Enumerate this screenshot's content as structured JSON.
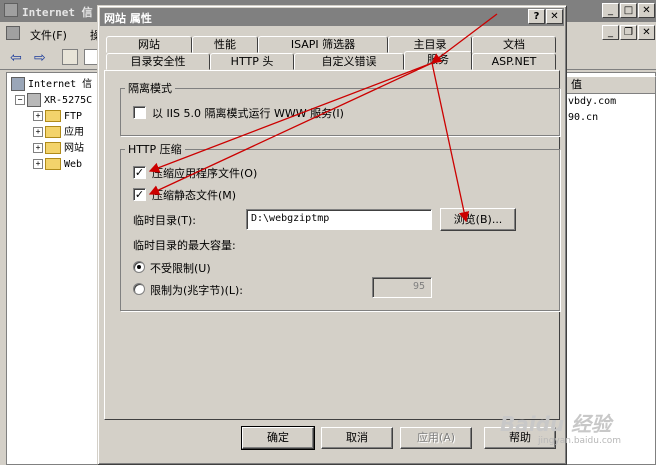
{
  "background_window": {
    "title": "Internet 信",
    "menu": {
      "file": "文件(F)",
      "action": "操"
    },
    "tree": {
      "root": "Internet 信",
      "server": "XR-5275C",
      "items": [
        "FTP",
        "应用",
        "网站",
        "Web"
      ]
    },
    "list_header": "值",
    "list_values": [
      "vbdy.com",
      "90.cn"
    ]
  },
  "dialog": {
    "title": "网站 属性",
    "tabs_row_back": [
      "网站",
      "性能",
      "ISAPI 筛选器",
      "主目录",
      "文档"
    ],
    "tabs_row_front": [
      "目录安全性",
      "HTTP 头",
      "自定义错误",
      "服务",
      "ASP.NET"
    ],
    "selected_tab": "服务",
    "isolation": {
      "group_label": "隔离模式",
      "checkbox_label": "以 IIS 5.0 隔离模式运行 WWW 服务(I)",
      "checked": false
    },
    "compression": {
      "group_label": "HTTP 压缩",
      "compress_app_files": {
        "label": "压缩应用程序文件(O)",
        "checked": true
      },
      "compress_static_files": {
        "label": "压缩静态文件(M)",
        "checked": true
      },
      "temp_dir_label": "临时目录(T):",
      "temp_dir_value": "D:\\webgziptmp",
      "browse_label": "浏览(B)...",
      "max_size_label": "临时目录的最大容量:",
      "unlimited_label": "不受限制(U)",
      "unlimited_selected": true,
      "limit_label": "限制为(兆字节)(L):",
      "limit_value": "95"
    },
    "buttons": {
      "ok": "确定",
      "cancel": "取消",
      "apply": "应用(A)",
      "help": "帮助"
    }
  },
  "watermark": {
    "brand": "Baidu 经验",
    "sub": "jingyan.baidu.com"
  },
  "colors": {
    "annotation_arrow": "#cc0000",
    "dialog_face": "#d4d0c8",
    "title_inactive": "#808080"
  }
}
